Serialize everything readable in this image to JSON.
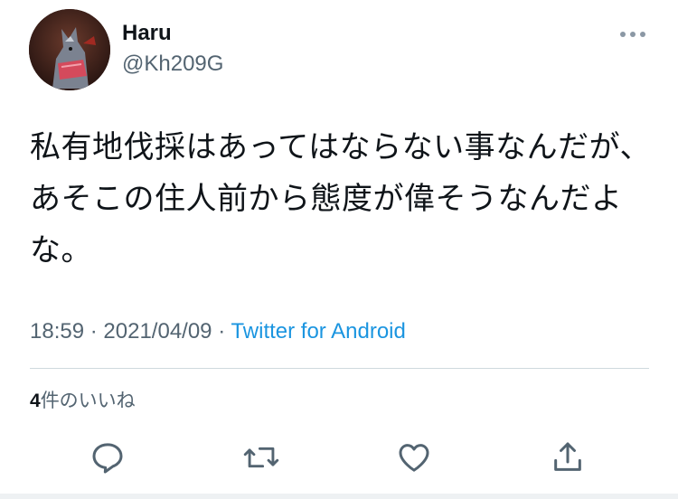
{
  "tweet": {
    "author": {
      "display_name": "Haru",
      "handle": "@Kh209G"
    },
    "text": "私有地伐採はあってはならない事なんだが、あそこの住人前から態度が偉そうなんだよな。",
    "time": "18:59",
    "date": "2021/04/09",
    "separator": "·",
    "source": "Twitter for Android",
    "likes": {
      "count": "4",
      "label": "件のいいね"
    }
  },
  "icons": {
    "more": "more-horizontal-icon",
    "reply": "reply-bubble-icon",
    "retweet": "retweet-icon",
    "like": "heart-icon",
    "share": "share-upload-icon"
  },
  "colors": {
    "text_primary": "#0f1419",
    "text_secondary": "#536471",
    "link": "#1b95e0",
    "divider": "#cfd9de"
  }
}
